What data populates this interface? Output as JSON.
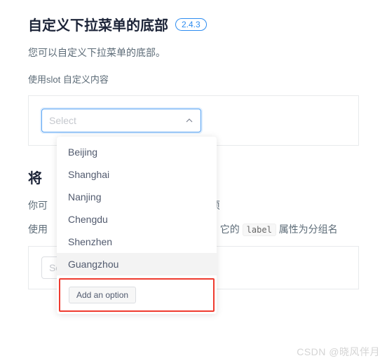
{
  "section1": {
    "title": "自定义下拉菜单的底部",
    "version": "2.4.3",
    "description": "您可以自定义下拉菜单的底部。",
    "sub_description": "使用slot 自定义内容",
    "select_placeholder": "Select",
    "options": [
      "Beijing",
      "Shanghai",
      "Nanjing",
      "Chengdu",
      "Shenzhen",
      "Guangzhou"
    ],
    "hovered_index": 5,
    "footer_button": "Add an option"
  },
  "section2": {
    "title_fragment": "将",
    "desc_line1_prefix": "你可",
    "desc_line1_suffix": "选项",
    "desc_line2_prefix": "使用",
    "desc_line2_mid": "组，它的",
    "desc_line2_code": "label",
    "desc_line2_suffix": "属性为分组名",
    "select_placeholder": "Select"
  },
  "watermark": "CSDN @晓风伴月"
}
